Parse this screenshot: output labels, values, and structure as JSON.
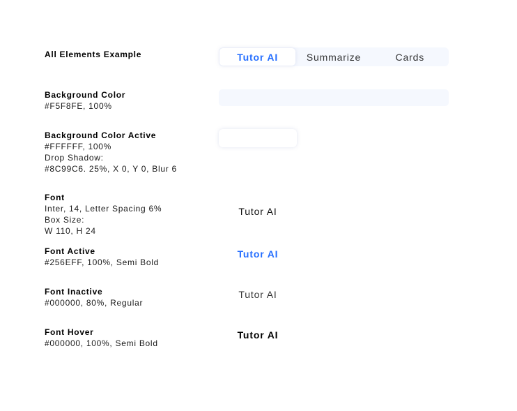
{
  "colors": {
    "tab_background": "#F5F8FE",
    "tab_active_background": "#FFFFFF",
    "shadow": "#8C99C6",
    "font_active": "#256EFF",
    "font_inactive": "#000000",
    "font_hover": "#000000"
  },
  "example": {
    "title": "All Elements Example",
    "tabs": [
      {
        "label": "Tutor AI",
        "state": "active"
      },
      {
        "label": "Summarize",
        "state": "inactive"
      },
      {
        "label": "Cards",
        "state": "inactive"
      }
    ]
  },
  "background_color": {
    "title": "Background Color",
    "lines": [
      "#F5F8FE, 100%"
    ]
  },
  "background_color_active": {
    "title": "Background Color Active",
    "lines": [
      "#FFFFFF, 100%",
      "Drop Shadow:",
      "#8C99C6. 25%, X 0, Y 0, Blur 6"
    ]
  },
  "font": {
    "title": "Font",
    "lines": [
      "Inter, 14, Letter Spacing 6%",
      "Box Size:",
      "W 110, H 24"
    ],
    "sample": "Tutor AI"
  },
  "font_active": {
    "title": "Font Active",
    "lines": [
      "#256EFF, 100%, Semi Bold"
    ],
    "sample": "Tutor AI"
  },
  "font_inactive": {
    "title": "Font Inactive",
    "lines": [
      "#000000, 80%, Regular"
    ],
    "sample": "Tutor AI"
  },
  "font_hover": {
    "title": "Font Hover",
    "lines": [
      "#000000, 100%, Semi Bold"
    ],
    "sample": "Tutor AI"
  }
}
